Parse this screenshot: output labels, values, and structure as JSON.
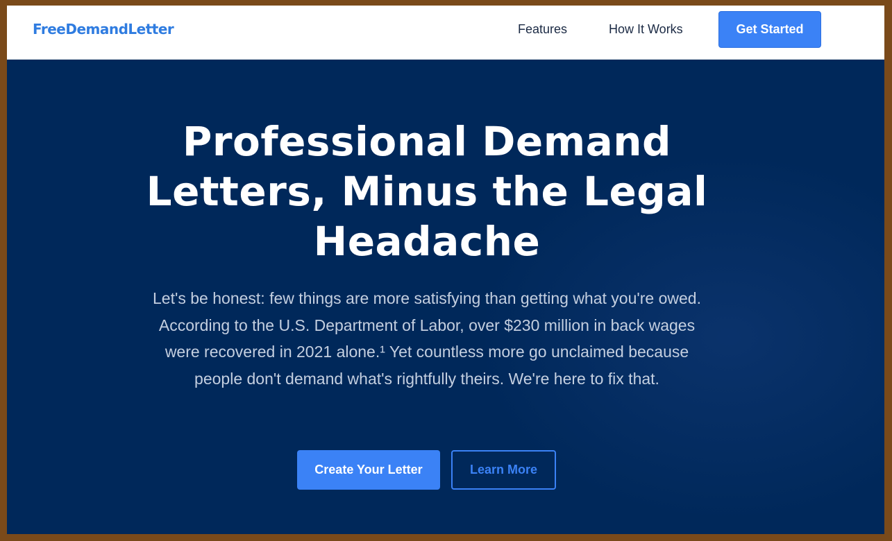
{
  "nav": {
    "logo": "FreeDemandLetter",
    "links": [
      "Features",
      "How It Works"
    ],
    "cta": "Get Started"
  },
  "hero": {
    "title": "Professional Demand Letters, Minus the Legal Headache",
    "text": "Let's be honest: few things are more satisfying than getting what you're owed. According to the U.S. Department of Labor, over $230 million in back wages were recovered in 2021 alone.¹ Yet countless more go unclaimed because people don't demand what's rightfully theirs. We're here to fix that.",
    "primary_button": "Create Your Letter",
    "secondary_button": "Learn More"
  },
  "colors": {
    "frame": "#7a4a1a",
    "hero_bg": "#00285a",
    "accent": "#3b82f6",
    "logo": "#2f7ce0"
  }
}
